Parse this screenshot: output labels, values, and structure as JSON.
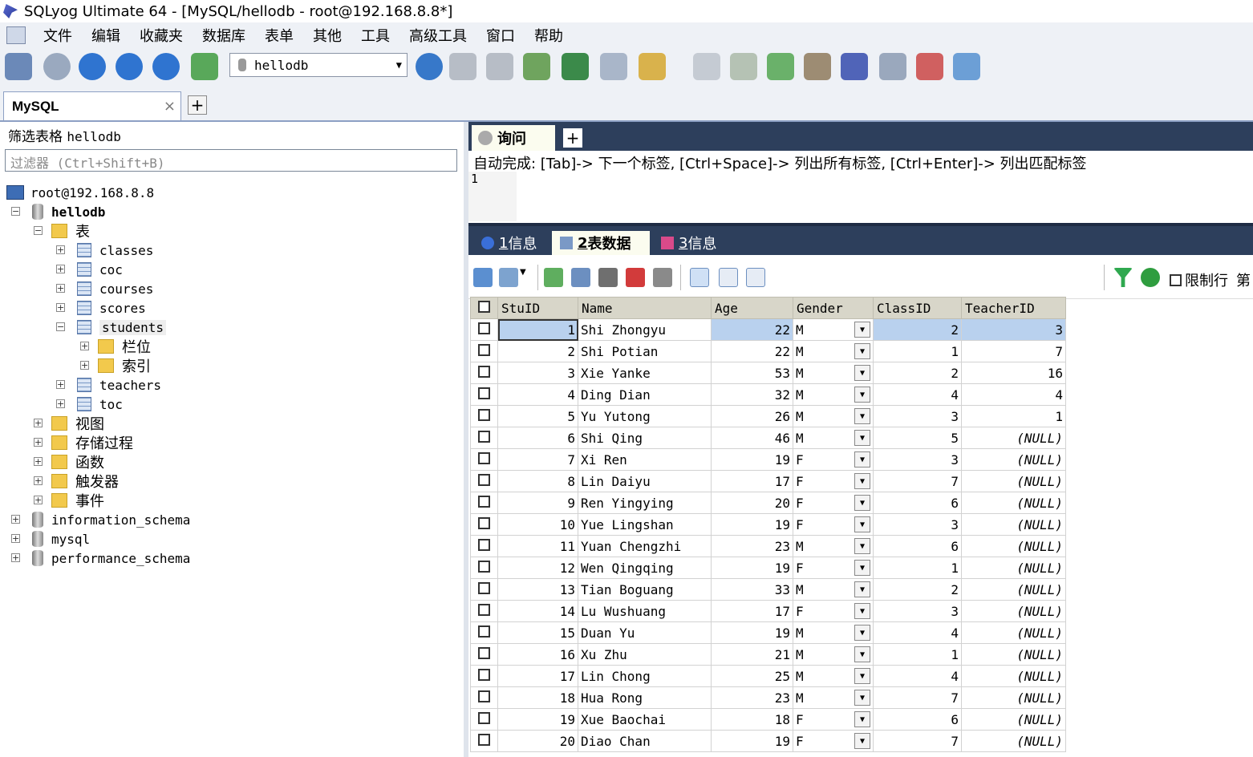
{
  "window": {
    "title": "SQLyog Ultimate 64 - [MySQL/hellodb - root@192.168.8.8*]"
  },
  "menu": [
    "文件",
    "编辑",
    "收藏夹",
    "数据库",
    "表单",
    "其他",
    "工具",
    "高级工具",
    "窗口",
    "帮助"
  ],
  "toolbar": {
    "database_selector": "hellodb"
  },
  "connection_tab": {
    "label": "MySQL",
    "close": "×",
    "add": "+"
  },
  "object_browser": {
    "filter_label": "筛选表格",
    "filter_db": "hellodb",
    "filter_placeholder": "过滤器 (Ctrl+Shift+B)",
    "server": "root@192.168.8.8",
    "database": "hellodb",
    "tables_folder": "表",
    "tables": [
      "classes",
      "coc",
      "courses",
      "scores",
      "students",
      "teachers",
      "toc"
    ],
    "students_children": [
      "栏位",
      "索引"
    ],
    "folders": [
      "视图",
      "存储过程",
      "函数",
      "触发器",
      "事件"
    ],
    "other_databases": [
      "information_schema",
      "mysql",
      "performance_schema"
    ],
    "expanded_sign": "−",
    "collapsed_sign": "+"
  },
  "query": {
    "tab_label": "询问",
    "add_tab": "+",
    "hint": "自动完成: [Tab]-> 下一个标签, [Ctrl+Space]-> 列出所有标签, [Ctrl+Enter]-> 列出匹配标签",
    "line_number": "1"
  },
  "result_tabs": [
    {
      "num": "1",
      "label": "信息"
    },
    {
      "num": "2",
      "label": "表数据"
    },
    {
      "num": "3",
      "label": "信息"
    }
  ],
  "grid_toolbar": {
    "limit_label": "限制行",
    "cut_label": "第"
  },
  "grid": {
    "columns": [
      "StuID",
      "Name",
      "Age",
      "Gender",
      "ClassID",
      "TeacherID"
    ],
    "rows": [
      [
        "1",
        "Shi Zhongyu",
        "22",
        "M",
        "2",
        "3"
      ],
      [
        "2",
        "Shi Potian",
        "22",
        "M",
        "1",
        "7"
      ],
      [
        "3",
        "Xie Yanke",
        "53",
        "M",
        "2",
        "16"
      ],
      [
        "4",
        "Ding Dian",
        "32",
        "M",
        "4",
        "4"
      ],
      [
        "5",
        "Yu Yutong",
        "26",
        "M",
        "3",
        "1"
      ],
      [
        "6",
        "Shi Qing",
        "46",
        "M",
        "5",
        "(NULL)"
      ],
      [
        "7",
        "Xi Ren",
        "19",
        "F",
        "3",
        "(NULL)"
      ],
      [
        "8",
        "Lin Daiyu",
        "17",
        "F",
        "7",
        "(NULL)"
      ],
      [
        "9",
        "Ren Yingying",
        "20",
        "F",
        "6",
        "(NULL)"
      ],
      [
        "10",
        "Yue Lingshan",
        "19",
        "F",
        "3",
        "(NULL)"
      ],
      [
        "11",
        "Yuan Chengzhi",
        "23",
        "M",
        "6",
        "(NULL)"
      ],
      [
        "12",
        "Wen Qingqing",
        "19",
        "F",
        "1",
        "(NULL)"
      ],
      [
        "13",
        "Tian Boguang",
        "33",
        "M",
        "2",
        "(NULL)"
      ],
      [
        "14",
        "Lu Wushuang",
        "17",
        "F",
        "3",
        "(NULL)"
      ],
      [
        "15",
        "Duan Yu",
        "19",
        "M",
        "4",
        "(NULL)"
      ],
      [
        "16",
        "Xu Zhu",
        "21",
        "M",
        "1",
        "(NULL)"
      ],
      [
        "17",
        "Lin Chong",
        "25",
        "M",
        "4",
        "(NULL)"
      ],
      [
        "18",
        "Hua Rong",
        "23",
        "M",
        "7",
        "(NULL)"
      ],
      [
        "19",
        "Xue Baochai",
        "18",
        "F",
        "6",
        "(NULL)"
      ],
      [
        "20",
        "Diao Chan",
        "19",
        "F",
        "7",
        "(NULL)"
      ]
    ],
    "dropdown_glyph": "▼"
  }
}
